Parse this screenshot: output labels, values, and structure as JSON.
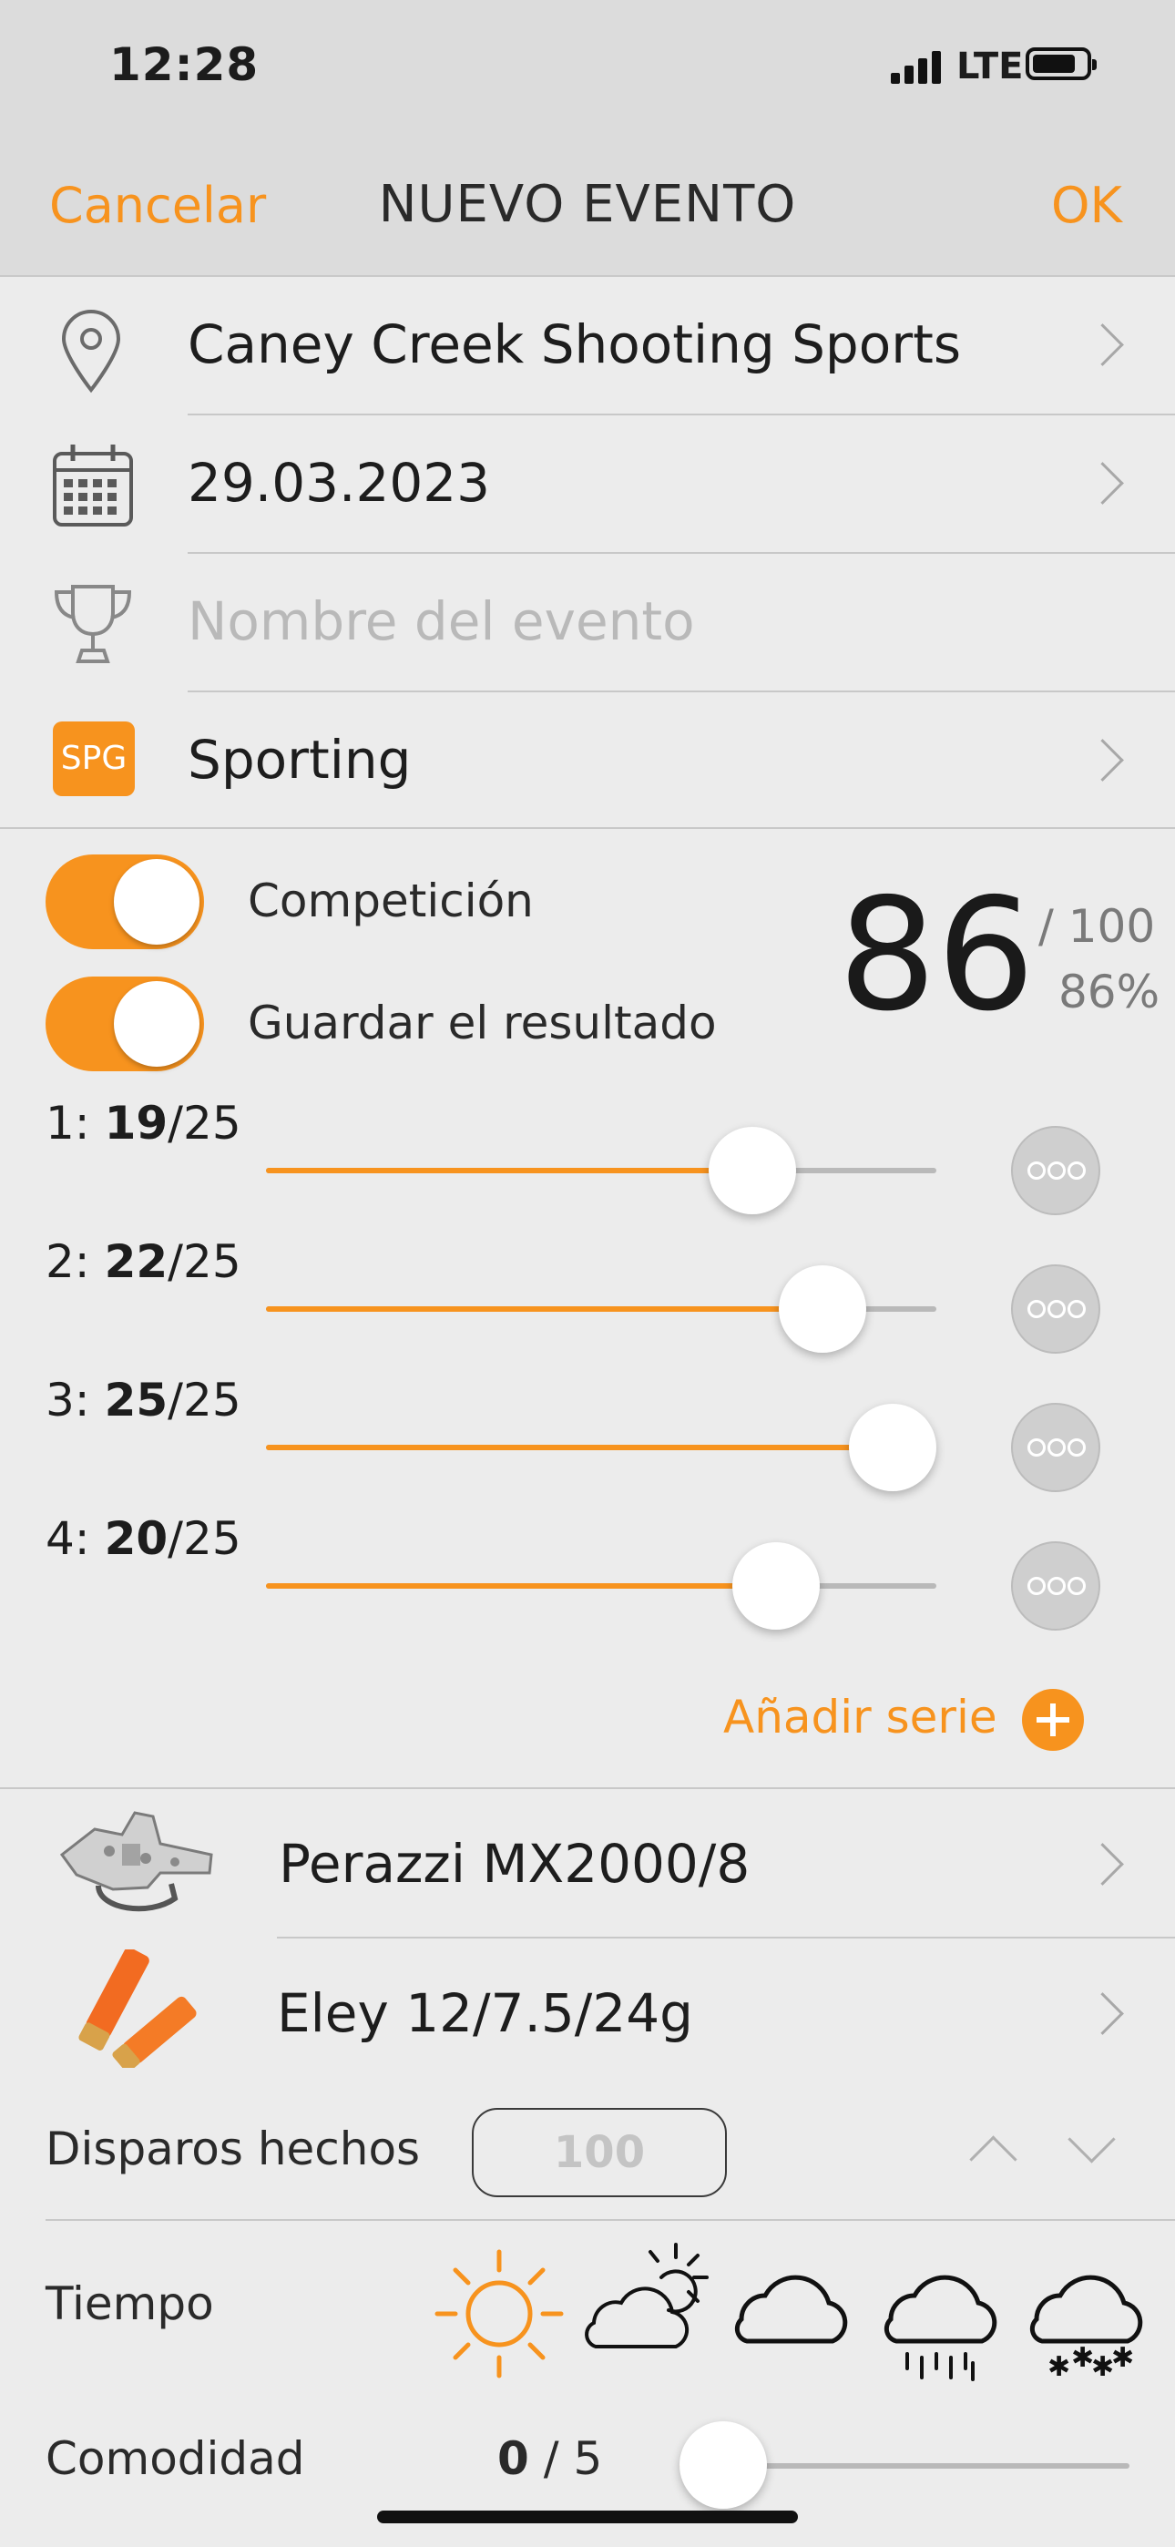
{
  "status_bar": {
    "time": "12:28",
    "network": "LTE"
  },
  "nav": {
    "cancel": "Cancelar",
    "title": "NUEVO EVENTO",
    "ok": "OK"
  },
  "location": {
    "icon": "location-pin-icon",
    "value": "Caney Creek Shooting Sports"
  },
  "date": {
    "icon": "calendar-icon",
    "value": "29.03.2023"
  },
  "event_name": {
    "icon": "trophy-icon",
    "placeholder": "Nombre del evento"
  },
  "discipline": {
    "badge": "SPG",
    "value": "Sporting"
  },
  "toggles": {
    "competition": {
      "label": "Competición",
      "on": true
    },
    "save_result": {
      "label": "Guardar el resultado",
      "on": true
    }
  },
  "score": {
    "value": "86",
    "total": "/ 100",
    "percent": "86%"
  },
  "series": [
    {
      "index": "1:",
      "hits": "19",
      "of": "/25",
      "fraction": 0.76
    },
    {
      "index": "2:",
      "hits": "22",
      "of": "/25",
      "fraction": 0.88
    },
    {
      "index": "3:",
      "hits": "25",
      "of": "/25",
      "fraction": 1.0
    },
    {
      "index": "4:",
      "hits": "20",
      "of": "/25",
      "fraction": 0.8
    }
  ],
  "add_series": {
    "label": "Añadir serie"
  },
  "gun": {
    "icon": "shotgun-trigger-icon",
    "value": "Perazzi MX2000/8"
  },
  "ammo": {
    "icon": "shotgun-shells-icon",
    "value": "Eley 12/7.5/24g"
  },
  "shots": {
    "label": "Disparos hechos",
    "value": "100"
  },
  "weather": {
    "label": "Tiempo",
    "options": [
      "sun-icon",
      "partly-cloudy-icon",
      "cloud-icon",
      "rain-icon",
      "snow-icon"
    ],
    "selected": "sun-icon"
  },
  "comfort": {
    "label": "Comodidad",
    "value": "0",
    "max": "/ 5",
    "fraction": 0
  },
  "colors": {
    "accent": "#f7931e",
    "background": "#ececec",
    "nav_background": "#dcdcdc"
  }
}
